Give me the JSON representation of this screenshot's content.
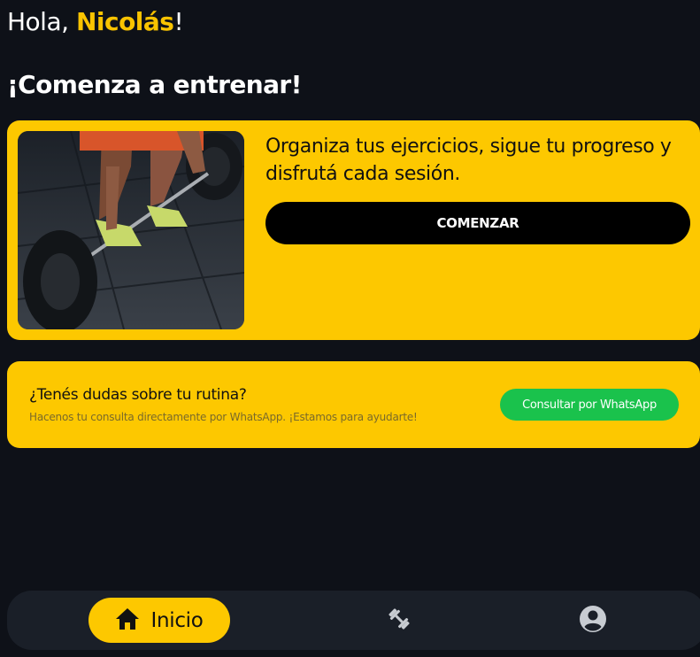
{
  "greeting": {
    "prefix": "Hola, ",
    "name": "Nicolás",
    "suffix": "!"
  },
  "headline": "¡Comenza a entrenar!",
  "hero": {
    "text": "Organiza tus ejercicios, sigue tu progreso y disfrutá cada sesión.",
    "button_label": "COMENZAR",
    "image": "weightlifting-barbell-photo"
  },
  "help": {
    "title": "¿Tenés dudas sobre tu rutina?",
    "subtitle": "Hacenos tu consulta directamente por WhatsApp. ¡Estamos para ayudarte!",
    "button_label": "Consultar por WhatsApp"
  },
  "nav": {
    "items": [
      {
        "label": "Inicio",
        "icon": "home-icon",
        "active": true
      },
      {
        "label": "",
        "icon": "dumbbell-icon",
        "active": false
      },
      {
        "label": "",
        "icon": "account-circle-icon",
        "active": false
      }
    ]
  },
  "colors": {
    "background": "#0e1118",
    "accent": "#fdc800",
    "whatsapp": "#1ac24c",
    "nav_bg": "#1a1f28"
  }
}
